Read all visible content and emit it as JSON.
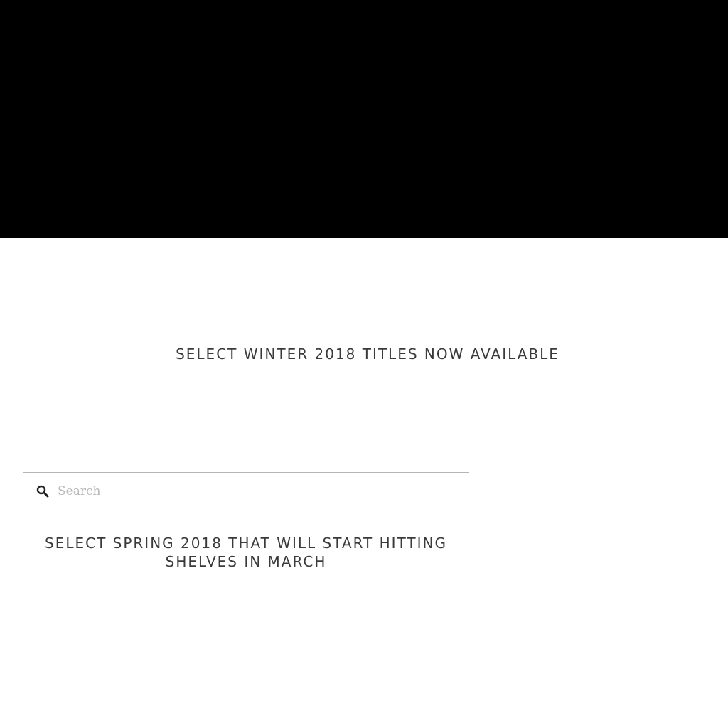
{
  "hero": {
    "background_color": "#000000"
  },
  "headline": {
    "text": "SELECT WINTER 2018 TITLES NOW AVAILABLE"
  },
  "search": {
    "placeholder": "Search",
    "value": "",
    "icon": "search-icon"
  },
  "subhead": {
    "text": "SELECT SPRING 2018 THAT WILL START HITTING SHELVES IN MARCH"
  },
  "colors": {
    "text": "#3a3a3a",
    "border": "#b5b5b5",
    "placeholder": "#b8b8b8"
  }
}
